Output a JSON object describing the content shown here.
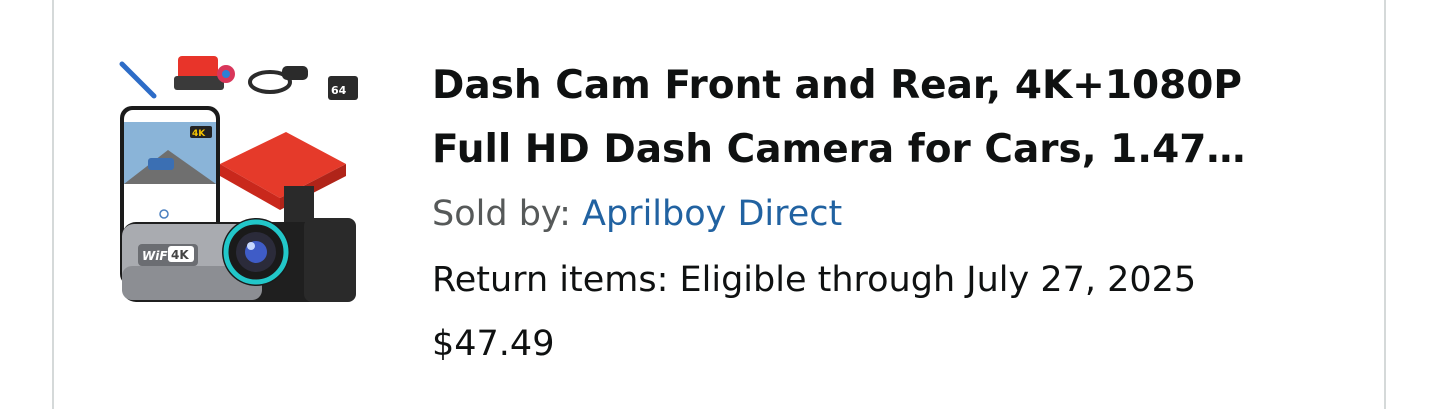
{
  "order_item": {
    "title_line1": "Dash Cam Front and Rear, 4K+1080P",
    "title_line2": "Full HD Dash Camera for Cars, 1.47…",
    "sold_by_label": "Sold by:",
    "seller_name": "Aprilboy Direct",
    "return_label": "Return items:",
    "return_status": "Eligible through July 27, 2025",
    "price": "$47.49"
  },
  "product_image": {
    "badge_4k_phone": "4K",
    "badge_wifi": "WiFi",
    "badge_4k_camera": "4K",
    "sd_card_text": "64"
  },
  "colors": {
    "seller_link": "#2162a1",
    "label_gray": "#565959",
    "text": "#0f1111",
    "card_border": "#d5d9d9"
  }
}
